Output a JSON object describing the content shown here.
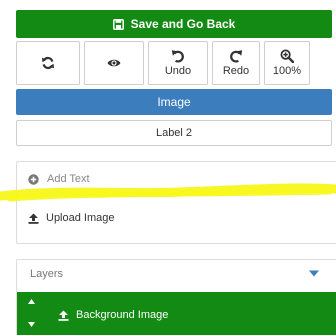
{
  "save": {
    "label": "Save and Go Back"
  },
  "toolbar": {
    "buttons": [
      {
        "icon": "refresh-icon",
        "label": ""
      },
      {
        "icon": "eye-icon",
        "label": ""
      },
      {
        "icon": "undo-icon",
        "label": "Undo"
      },
      {
        "icon": "redo-icon",
        "label": "Redo"
      },
      {
        "icon": "zoom-in-icon",
        "label": "100%"
      }
    ]
  },
  "tabs": {
    "image": "Image",
    "label2": "Label 2"
  },
  "tools": {
    "add_text": "Add Text",
    "upload_image": "Upload Image"
  },
  "layers": {
    "title": "Layers",
    "items": [
      {
        "label": "Background Image"
      }
    ]
  },
  "colors": {
    "accent_green": "#138a13",
    "accent_blue": "#3b7dbd",
    "highlight_yellow": "#f7f71a"
  }
}
